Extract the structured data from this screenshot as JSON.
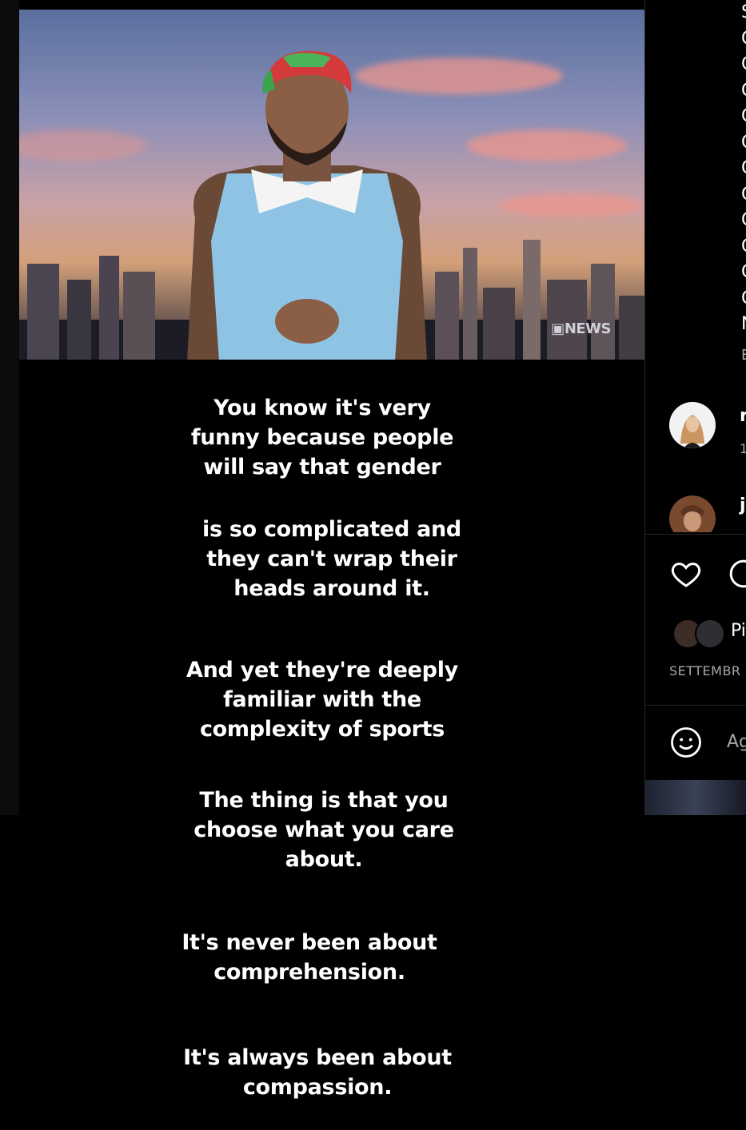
{
  "post": {
    "watermark": "NEWS",
    "caption_blocks": [
      "You know it's very\nfunny because people\nwill say that gender",
      "is so complicated and\nthey can't wrap their\nheads around it.",
      "And yet they're deeply\nfamiliar with the\ncomplexity of sports",
      "The thing is that you\nchoose what you care\nabout.",
      "It's never been about\ncomprehension.",
      "It's always been about\ncompassion."
    ]
  },
  "sidebar": {
    "caption_letters": [
      "S",
      "C",
      "C",
      "C",
      "C",
      "C",
      "C",
      "C",
      "C",
      "C",
      "C",
      "C",
      "N",
      "E"
    ],
    "comments": [
      {
        "initial": "r",
        "sub": "1"
      },
      {
        "initial": "j"
      }
    ],
    "actions": {
      "like_icon": "heart-icon",
      "comment_icon": "comment-icon"
    },
    "likes_text": "Pi",
    "date_text": "SETTEMBR",
    "emoji_icon": "smiley-icon",
    "comment_placeholder": "Ag"
  }
}
